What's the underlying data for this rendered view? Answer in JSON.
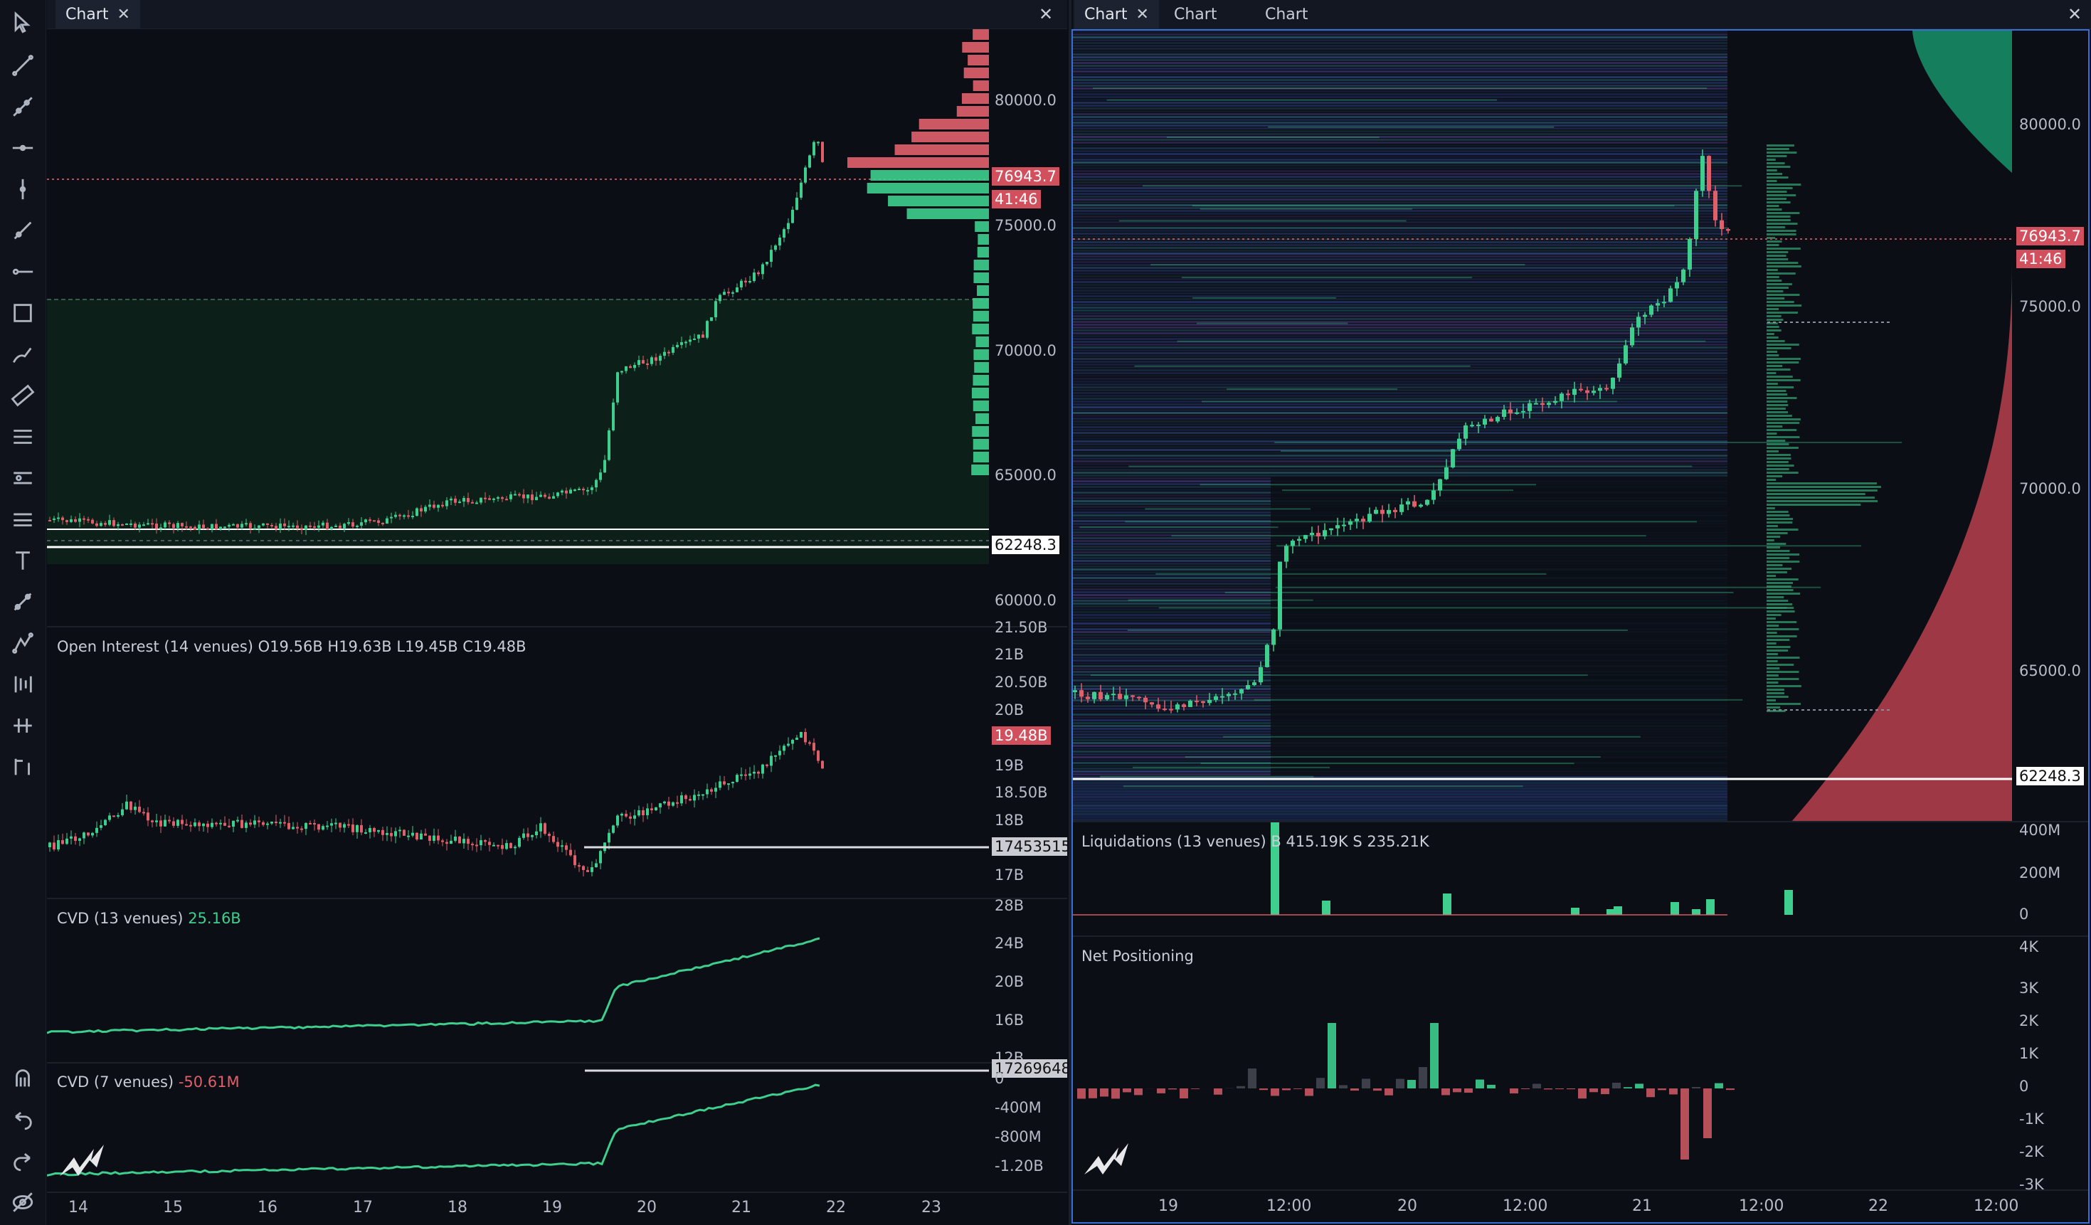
{
  "left_window": {
    "tab": {
      "label": "Chart"
    },
    "price_axis": [
      "80000.0",
      "75000.0",
      "70000.0",
      "65000.0",
      "60000.0"
    ],
    "price_tag": "76943.7",
    "countdown_tag": "41:46",
    "level_tag": "62248.3",
    "oi": {
      "title": "Open Interest (14 venues)",
      "values": "O19.56B  H19.63B  L19.45B  C19.48B",
      "axis": [
        "21.50B",
        "21B",
        "20.50B",
        "20B",
        "19B",
        "18.50B",
        "18B",
        "17B"
      ],
      "value_tag": "19.48B",
      "level_tag": "17453515"
    },
    "cvd13": {
      "title": "CVD (13 venues)",
      "value": "25.16B",
      "axis": [
        "28B",
        "24B",
        "20B",
        "16B",
        "12B"
      ],
      "level_tag": "17269648"
    },
    "cvd7": {
      "title": "CVD (7 venues)",
      "value": "-50.61M",
      "axis": [
        "0",
        "-400M",
        "-800M",
        "-1.20B"
      ]
    },
    "x_axis": [
      "14",
      "15",
      "16",
      "17",
      "18",
      "19",
      "20",
      "21",
      "22",
      "23"
    ]
  },
  "right_window": {
    "tabs": [
      {
        "label": "Chart"
      },
      {
        "label": "Chart"
      },
      {
        "label": "Chart"
      }
    ],
    "price_axis": [
      "80000.0",
      "75000.0",
      "70000.0",
      "65000.0"
    ],
    "price_tag": "76943.7",
    "countdown_tag": "41:46",
    "level_tag": "62248.3",
    "liq": {
      "title": "Liquidations (13 venues)",
      "values": "B 415.19K  S 235.21K",
      "axis": [
        "400M",
        "200M",
        "0"
      ]
    },
    "net": {
      "title": "Net Positioning",
      "axis": [
        "4K",
        "3K",
        "2K",
        "1K",
        "0",
        "-1K",
        "-2K",
        "-3K"
      ]
    },
    "x_axis": [
      "19",
      "12:00",
      "20",
      "12:00",
      "21",
      "12:00",
      "22",
      "12:00"
    ]
  },
  "colors": {
    "up": "#3ecf8e",
    "down": "#e0606a",
    "tag_red": "#d2505e",
    "accent_border": "#3b6fd8"
  },
  "tools": [
    "cursor-icon",
    "trend-line-icon",
    "ray-icon",
    "horizontal-line-icon",
    "vertical-line-icon",
    "extended-line-icon",
    "horizontal-ray-icon",
    "rectangle-icon",
    "brush-icon",
    "ruler-icon",
    "fib-retracement-icon",
    "fib-extension-icon",
    "pitchfork-icon",
    "text-icon",
    "path-icon",
    "pattern-icon",
    "long-position-icon",
    "short-position-icon",
    "measure-icon",
    "magnet-icon",
    "undo-icon",
    "redo-icon",
    "hide-drawings-icon"
  ]
}
